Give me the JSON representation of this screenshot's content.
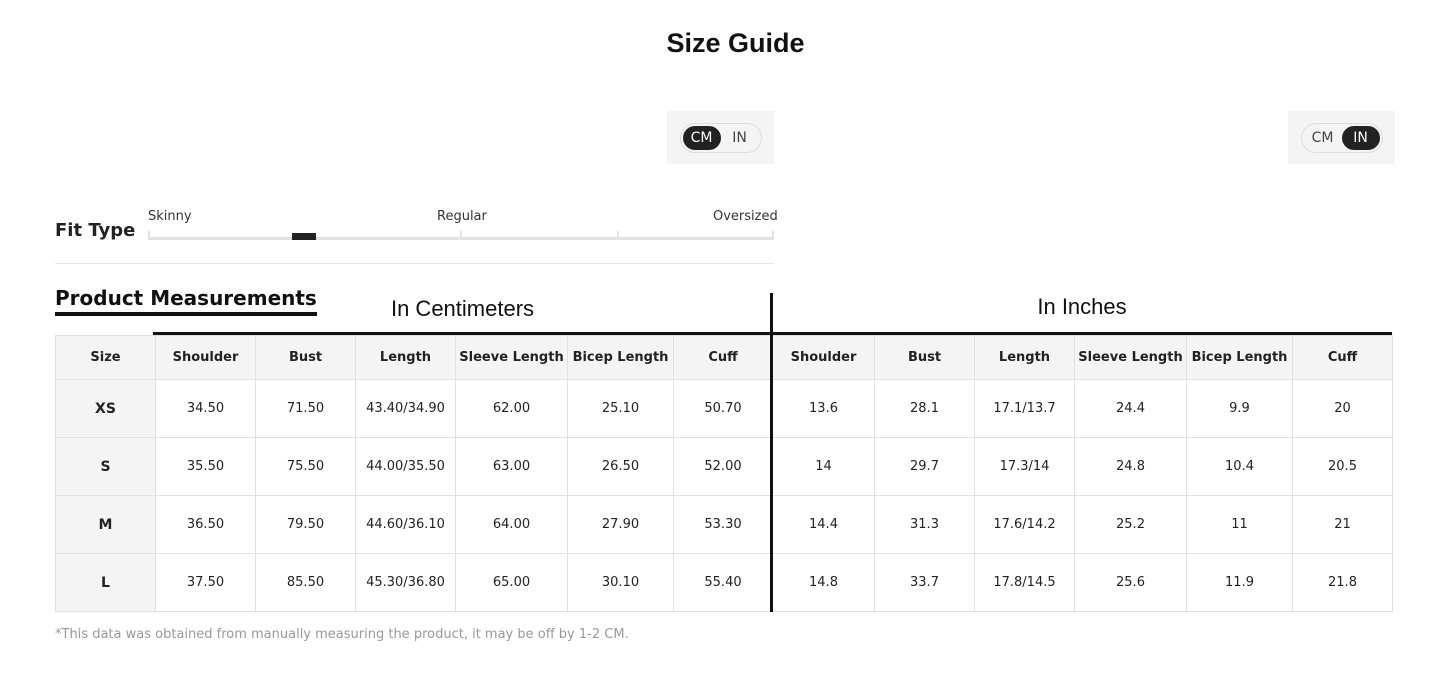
{
  "page": {
    "title": "Size Guide"
  },
  "unit_toggles": {
    "left": {
      "options": [
        "CM",
        "IN"
      ],
      "selected": "CM"
    },
    "right": {
      "options": [
        "CM",
        "IN"
      ],
      "selected": "IN"
    }
  },
  "fit_type": {
    "label": "Fit Type",
    "scale_labels": [
      "Skinny",
      "Regular",
      "Oversized"
    ],
    "selected_level": 0.24
  },
  "product_measurements": {
    "title": "Product Measurements",
    "cm_group_title": "In Centimeters",
    "in_group_title": "In Inches",
    "size_header": "Size",
    "cm_headers": [
      "Shoulder",
      "Bust",
      "Length",
      "Sleeve Length",
      "Bicep Length",
      "Cuff"
    ],
    "in_headers": [
      "Shoulder",
      "Bust",
      "Length",
      "Sleeve Length",
      "Bicep Length",
      "Cuff"
    ],
    "rows": [
      {
        "size": "XS",
        "cm": [
          "34.50",
          "71.50",
          "43.40/34.90",
          "62.00",
          "25.10",
          "50.70"
        ],
        "in": [
          "13.6",
          "28.1",
          "17.1/13.7",
          "24.4",
          "9.9",
          "20"
        ]
      },
      {
        "size": "S",
        "cm": [
          "35.50",
          "75.50",
          "44.00/35.50",
          "63.00",
          "26.50",
          "52.00"
        ],
        "in": [
          "14",
          "29.7",
          "17.3/14",
          "24.8",
          "10.4",
          "20.5"
        ]
      },
      {
        "size": "M",
        "cm": [
          "36.50",
          "79.50",
          "44.60/36.10",
          "64.00",
          "27.90",
          "53.30"
        ],
        "in": [
          "14.4",
          "31.3",
          "17.6/14.2",
          "25.2",
          "11",
          "21"
        ]
      },
      {
        "size": "L",
        "cm": [
          "37.50",
          "85.50",
          "45.30/36.80",
          "65.00",
          "30.10",
          "55.40"
        ],
        "in": [
          "14.8",
          "33.7",
          "17.8/14.5",
          "25.6",
          "11.9",
          "21.8"
        ]
      }
    ],
    "footnote": "*This data was obtained from manually measuring the product, it may be off by 1-2 CM."
  }
}
